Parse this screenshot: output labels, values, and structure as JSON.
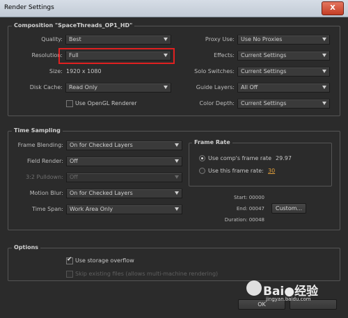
{
  "window": {
    "title": "Render Settings",
    "close_glyph": "X"
  },
  "composition": {
    "group_label": "Composition \"SpaceThreads_OP1_HD\"",
    "left": [
      {
        "label": "Quality:",
        "value": "Best"
      },
      {
        "label": "Resolution:",
        "value": "Full"
      }
    ],
    "size_label": "Size:",
    "size_value": "1920 x 1080",
    "disk_cache_label": "Disk Cache:",
    "disk_cache_value": "Read Only",
    "opengl_label": "Use OpenGL Renderer",
    "opengl_checked": false,
    "right": [
      {
        "label": "Proxy Use:",
        "value": "Use No Proxies"
      },
      {
        "label": "Effects:",
        "value": "Current Settings"
      },
      {
        "label": "Solo Switches:",
        "value": "Current Settings"
      },
      {
        "label": "Guide Layers:",
        "value": "All Off"
      },
      {
        "label": "Color Depth:",
        "value": "Current Settings"
      }
    ]
  },
  "time_sampling": {
    "group_label": "Time Sampling",
    "rows": [
      {
        "label": "Frame Blending:",
        "value": "On for Checked Layers",
        "enabled": true
      },
      {
        "label": "Field Render:",
        "value": "Off",
        "enabled": true
      },
      {
        "label": "3:2 Pulldown:",
        "value": "Off",
        "enabled": false
      },
      {
        "label": "Motion Blur:",
        "value": "On for Checked Layers",
        "enabled": true
      },
      {
        "label": "Time Span:",
        "value": "Work Area Only",
        "enabled": true
      }
    ],
    "frame_rate": {
      "label": "Frame Rate",
      "option1_label": "Use comp's frame rate",
      "option1_value": "29.97",
      "option2_label": "Use this frame rate:",
      "option2_value": "30",
      "selected": 1
    },
    "start_label": "Start: 00000",
    "end_label": "End: 00047",
    "duration_label": "Duration: 00048",
    "custom_button": "Custom..."
  },
  "options": {
    "group_label": "Options",
    "storage_overflow_label": "Use storage overflow",
    "storage_overflow_checked": true,
    "skip_files_label": "Skip existing files (allows multi-machine rendering)",
    "skip_files_checked": false
  },
  "footer": {
    "ok_label": "OK"
  },
  "watermark": {
    "brand": "Bai●经验",
    "url": "jingyan.baidu.com"
  },
  "colors": {
    "highlight": "#e02020",
    "link": "#e6a23c",
    "background": "#2b2b2b"
  }
}
